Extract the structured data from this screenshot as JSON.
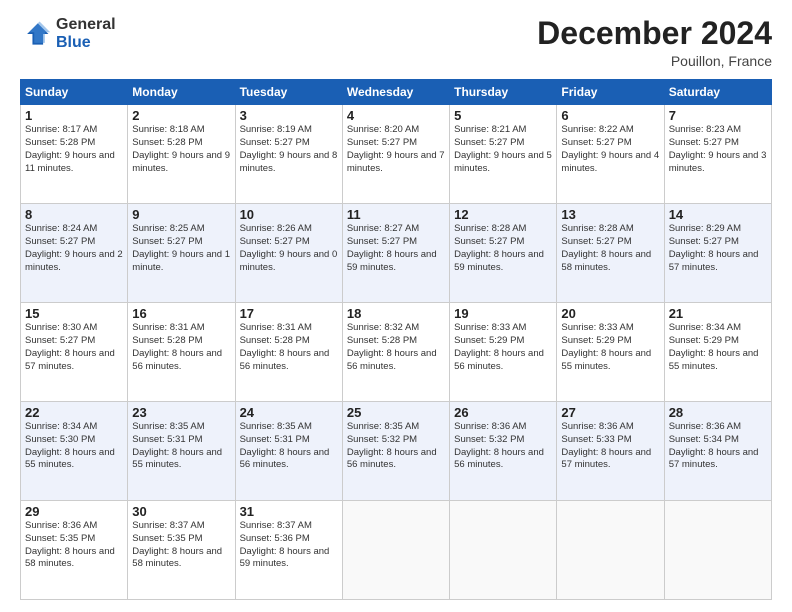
{
  "logo": {
    "line1": "General",
    "line2": "Blue"
  },
  "header": {
    "month": "December 2024",
    "location": "Pouillon, France"
  },
  "weekdays": [
    "Sunday",
    "Monday",
    "Tuesday",
    "Wednesday",
    "Thursday",
    "Friday",
    "Saturday"
  ],
  "weeks": [
    [
      {
        "day": "1",
        "sunrise": "8:17 AM",
        "sunset": "5:28 PM",
        "daylight": "9 hours and 11 minutes."
      },
      {
        "day": "2",
        "sunrise": "8:18 AM",
        "sunset": "5:28 PM",
        "daylight": "9 hours and 9 minutes."
      },
      {
        "day": "3",
        "sunrise": "8:19 AM",
        "sunset": "5:27 PM",
        "daylight": "9 hours and 8 minutes."
      },
      {
        "day": "4",
        "sunrise": "8:20 AM",
        "sunset": "5:27 PM",
        "daylight": "9 hours and 7 minutes."
      },
      {
        "day": "5",
        "sunrise": "8:21 AM",
        "sunset": "5:27 PM",
        "daylight": "9 hours and 5 minutes."
      },
      {
        "day": "6",
        "sunrise": "8:22 AM",
        "sunset": "5:27 PM",
        "daylight": "9 hours and 4 minutes."
      },
      {
        "day": "7",
        "sunrise": "8:23 AM",
        "sunset": "5:27 PM",
        "daylight": "9 hours and 3 minutes."
      }
    ],
    [
      {
        "day": "8",
        "sunrise": "8:24 AM",
        "sunset": "5:27 PM",
        "daylight": "9 hours and 2 minutes."
      },
      {
        "day": "9",
        "sunrise": "8:25 AM",
        "sunset": "5:27 PM",
        "daylight": "9 hours and 1 minute."
      },
      {
        "day": "10",
        "sunrise": "8:26 AM",
        "sunset": "5:27 PM",
        "daylight": "9 hours and 0 minutes."
      },
      {
        "day": "11",
        "sunrise": "8:27 AM",
        "sunset": "5:27 PM",
        "daylight": "8 hours and 59 minutes."
      },
      {
        "day": "12",
        "sunrise": "8:28 AM",
        "sunset": "5:27 PM",
        "daylight": "8 hours and 59 minutes."
      },
      {
        "day": "13",
        "sunrise": "8:28 AM",
        "sunset": "5:27 PM",
        "daylight": "8 hours and 58 minutes."
      },
      {
        "day": "14",
        "sunrise": "8:29 AM",
        "sunset": "5:27 PM",
        "daylight": "8 hours and 57 minutes."
      }
    ],
    [
      {
        "day": "15",
        "sunrise": "8:30 AM",
        "sunset": "5:27 PM",
        "daylight": "8 hours and 57 minutes."
      },
      {
        "day": "16",
        "sunrise": "8:31 AM",
        "sunset": "5:28 PM",
        "daylight": "8 hours and 56 minutes."
      },
      {
        "day": "17",
        "sunrise": "8:31 AM",
        "sunset": "5:28 PM",
        "daylight": "8 hours and 56 minutes."
      },
      {
        "day": "18",
        "sunrise": "8:32 AM",
        "sunset": "5:28 PM",
        "daylight": "8 hours and 56 minutes."
      },
      {
        "day": "19",
        "sunrise": "8:33 AM",
        "sunset": "5:29 PM",
        "daylight": "8 hours and 56 minutes."
      },
      {
        "day": "20",
        "sunrise": "8:33 AM",
        "sunset": "5:29 PM",
        "daylight": "8 hours and 55 minutes."
      },
      {
        "day": "21",
        "sunrise": "8:34 AM",
        "sunset": "5:29 PM",
        "daylight": "8 hours and 55 minutes."
      }
    ],
    [
      {
        "day": "22",
        "sunrise": "8:34 AM",
        "sunset": "5:30 PM",
        "daylight": "8 hours and 55 minutes."
      },
      {
        "day": "23",
        "sunrise": "8:35 AM",
        "sunset": "5:31 PM",
        "daylight": "8 hours and 55 minutes."
      },
      {
        "day": "24",
        "sunrise": "8:35 AM",
        "sunset": "5:31 PM",
        "daylight": "8 hours and 56 minutes."
      },
      {
        "day": "25",
        "sunrise": "8:35 AM",
        "sunset": "5:32 PM",
        "daylight": "8 hours and 56 minutes."
      },
      {
        "day": "26",
        "sunrise": "8:36 AM",
        "sunset": "5:32 PM",
        "daylight": "8 hours and 56 minutes."
      },
      {
        "day": "27",
        "sunrise": "8:36 AM",
        "sunset": "5:33 PM",
        "daylight": "8 hours and 57 minutes."
      },
      {
        "day": "28",
        "sunrise": "8:36 AM",
        "sunset": "5:34 PM",
        "daylight": "8 hours and 57 minutes."
      }
    ],
    [
      {
        "day": "29",
        "sunrise": "8:36 AM",
        "sunset": "5:35 PM",
        "daylight": "8 hours and 58 minutes."
      },
      {
        "day": "30",
        "sunrise": "8:37 AM",
        "sunset": "5:35 PM",
        "daylight": "8 hours and 58 minutes."
      },
      {
        "day": "31",
        "sunrise": "8:37 AM",
        "sunset": "5:36 PM",
        "daylight": "8 hours and 59 minutes."
      },
      null,
      null,
      null,
      null
    ]
  ],
  "labels": {
    "sunrise": "Sunrise:",
    "sunset": "Sunset:",
    "daylight": "Daylight:"
  }
}
